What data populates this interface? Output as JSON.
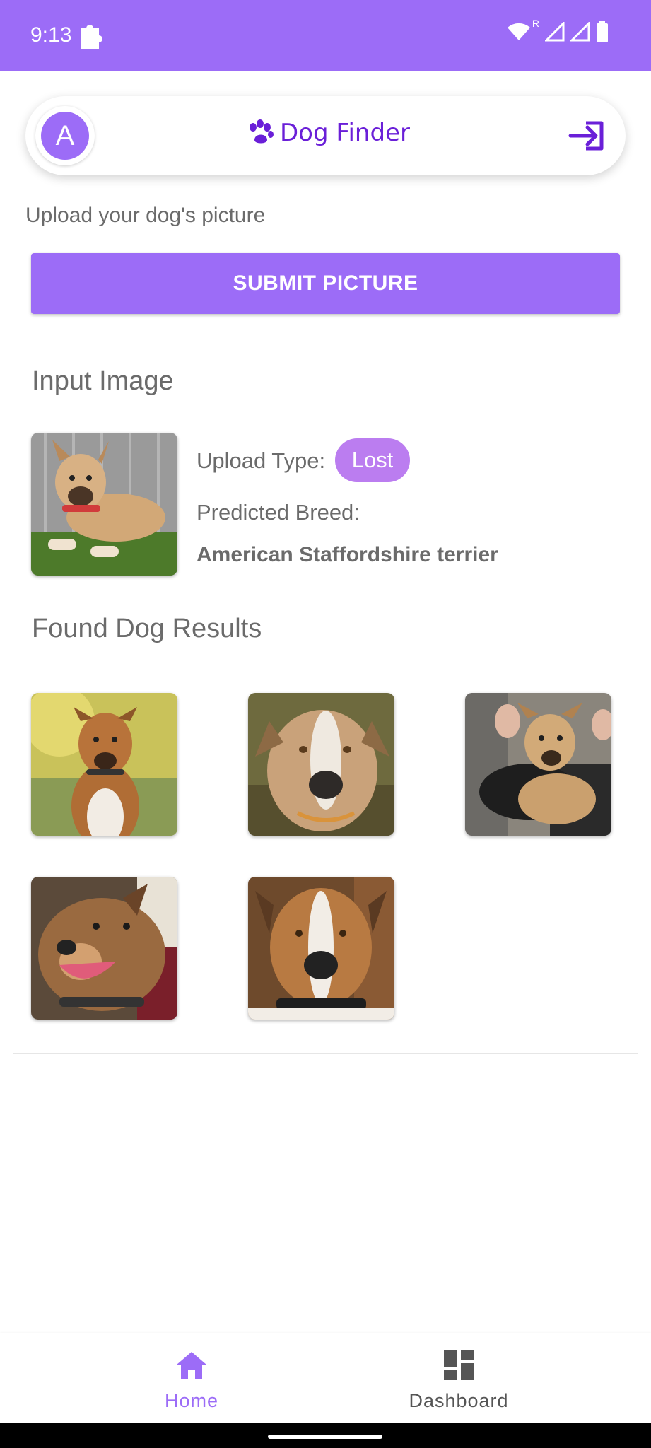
{
  "status_bar": {
    "time": "9:13",
    "roaming_indicator": "R",
    "icons": [
      "puzzle-icon",
      "wifi-icon",
      "signal-icon",
      "battery-icon"
    ]
  },
  "header": {
    "avatar_letter": "A",
    "brand_name": "Dog Finder",
    "brand_icon": "paw-icon",
    "login_icon": "login-icon"
  },
  "upload": {
    "label": "Upload your dog's picture",
    "submit_label": "SUBMIT PICTURE"
  },
  "input_section": {
    "title": "Input Image",
    "upload_type_label": "Upload Type:",
    "upload_type_value": "Lost",
    "predicted_breed_label": "Predicted Breed:",
    "predicted_breed_value": "American Staffordshire terrier"
  },
  "results_section": {
    "title": "Found Dog Results",
    "results": [
      {
        "name": "found-dog-1"
      },
      {
        "name": "found-dog-2"
      },
      {
        "name": "found-dog-3"
      },
      {
        "name": "found-dog-4"
      },
      {
        "name": "found-dog-5"
      }
    ]
  },
  "bottom_nav": {
    "items": [
      {
        "label": "Home",
        "icon": "home-icon",
        "active": true
      },
      {
        "label": "Dashboard",
        "icon": "dashboard-icon",
        "active": false
      }
    ]
  },
  "colors": {
    "primary": "#9c6cf7",
    "brand_text": "#6a1fd8",
    "chip": "#bb7df0",
    "active_nav": "#9c6cf7",
    "inactive_nav": "#555555",
    "text": "#6b6b6b"
  }
}
